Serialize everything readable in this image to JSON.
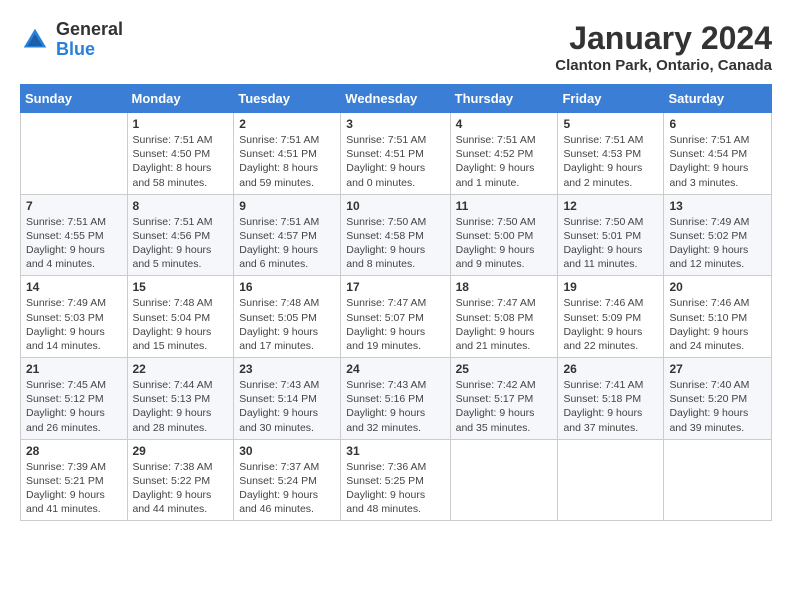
{
  "header": {
    "logo": {
      "general": "General",
      "blue": "Blue"
    },
    "title": "January 2024",
    "location": "Clanton Park, Ontario, Canada"
  },
  "calendar": {
    "days_of_week": [
      "Sunday",
      "Monday",
      "Tuesday",
      "Wednesday",
      "Thursday",
      "Friday",
      "Saturday"
    ],
    "weeks": [
      [
        {
          "day": "",
          "info": ""
        },
        {
          "day": "1",
          "info": "Sunrise: 7:51 AM\nSunset: 4:50 PM\nDaylight: 8 hours\nand 58 minutes."
        },
        {
          "day": "2",
          "info": "Sunrise: 7:51 AM\nSunset: 4:51 PM\nDaylight: 8 hours\nand 59 minutes."
        },
        {
          "day": "3",
          "info": "Sunrise: 7:51 AM\nSunset: 4:51 PM\nDaylight: 9 hours\nand 0 minutes."
        },
        {
          "day": "4",
          "info": "Sunrise: 7:51 AM\nSunset: 4:52 PM\nDaylight: 9 hours\nand 1 minute."
        },
        {
          "day": "5",
          "info": "Sunrise: 7:51 AM\nSunset: 4:53 PM\nDaylight: 9 hours\nand 2 minutes."
        },
        {
          "day": "6",
          "info": "Sunrise: 7:51 AM\nSunset: 4:54 PM\nDaylight: 9 hours\nand 3 minutes."
        }
      ],
      [
        {
          "day": "7",
          "info": "Sunrise: 7:51 AM\nSunset: 4:55 PM\nDaylight: 9 hours\nand 4 minutes."
        },
        {
          "day": "8",
          "info": "Sunrise: 7:51 AM\nSunset: 4:56 PM\nDaylight: 9 hours\nand 5 minutes."
        },
        {
          "day": "9",
          "info": "Sunrise: 7:51 AM\nSunset: 4:57 PM\nDaylight: 9 hours\nand 6 minutes."
        },
        {
          "day": "10",
          "info": "Sunrise: 7:50 AM\nSunset: 4:58 PM\nDaylight: 9 hours\nand 8 minutes."
        },
        {
          "day": "11",
          "info": "Sunrise: 7:50 AM\nSunset: 5:00 PM\nDaylight: 9 hours\nand 9 minutes."
        },
        {
          "day": "12",
          "info": "Sunrise: 7:50 AM\nSunset: 5:01 PM\nDaylight: 9 hours\nand 11 minutes."
        },
        {
          "day": "13",
          "info": "Sunrise: 7:49 AM\nSunset: 5:02 PM\nDaylight: 9 hours\nand 12 minutes."
        }
      ],
      [
        {
          "day": "14",
          "info": "Sunrise: 7:49 AM\nSunset: 5:03 PM\nDaylight: 9 hours\nand 14 minutes."
        },
        {
          "day": "15",
          "info": "Sunrise: 7:48 AM\nSunset: 5:04 PM\nDaylight: 9 hours\nand 15 minutes."
        },
        {
          "day": "16",
          "info": "Sunrise: 7:48 AM\nSunset: 5:05 PM\nDaylight: 9 hours\nand 17 minutes."
        },
        {
          "day": "17",
          "info": "Sunrise: 7:47 AM\nSunset: 5:07 PM\nDaylight: 9 hours\nand 19 minutes."
        },
        {
          "day": "18",
          "info": "Sunrise: 7:47 AM\nSunset: 5:08 PM\nDaylight: 9 hours\nand 21 minutes."
        },
        {
          "day": "19",
          "info": "Sunrise: 7:46 AM\nSunset: 5:09 PM\nDaylight: 9 hours\nand 22 minutes."
        },
        {
          "day": "20",
          "info": "Sunrise: 7:46 AM\nSunset: 5:10 PM\nDaylight: 9 hours\nand 24 minutes."
        }
      ],
      [
        {
          "day": "21",
          "info": "Sunrise: 7:45 AM\nSunset: 5:12 PM\nDaylight: 9 hours\nand 26 minutes."
        },
        {
          "day": "22",
          "info": "Sunrise: 7:44 AM\nSunset: 5:13 PM\nDaylight: 9 hours\nand 28 minutes."
        },
        {
          "day": "23",
          "info": "Sunrise: 7:43 AM\nSunset: 5:14 PM\nDaylight: 9 hours\nand 30 minutes."
        },
        {
          "day": "24",
          "info": "Sunrise: 7:43 AM\nSunset: 5:16 PM\nDaylight: 9 hours\nand 32 minutes."
        },
        {
          "day": "25",
          "info": "Sunrise: 7:42 AM\nSunset: 5:17 PM\nDaylight: 9 hours\nand 35 minutes."
        },
        {
          "day": "26",
          "info": "Sunrise: 7:41 AM\nSunset: 5:18 PM\nDaylight: 9 hours\nand 37 minutes."
        },
        {
          "day": "27",
          "info": "Sunrise: 7:40 AM\nSunset: 5:20 PM\nDaylight: 9 hours\nand 39 minutes."
        }
      ],
      [
        {
          "day": "28",
          "info": "Sunrise: 7:39 AM\nSunset: 5:21 PM\nDaylight: 9 hours\nand 41 minutes."
        },
        {
          "day": "29",
          "info": "Sunrise: 7:38 AM\nSunset: 5:22 PM\nDaylight: 9 hours\nand 44 minutes."
        },
        {
          "day": "30",
          "info": "Sunrise: 7:37 AM\nSunset: 5:24 PM\nDaylight: 9 hours\nand 46 minutes."
        },
        {
          "day": "31",
          "info": "Sunrise: 7:36 AM\nSunset: 5:25 PM\nDaylight: 9 hours\nand 48 minutes."
        },
        {
          "day": "",
          "info": ""
        },
        {
          "day": "",
          "info": ""
        },
        {
          "day": "",
          "info": ""
        }
      ]
    ]
  }
}
